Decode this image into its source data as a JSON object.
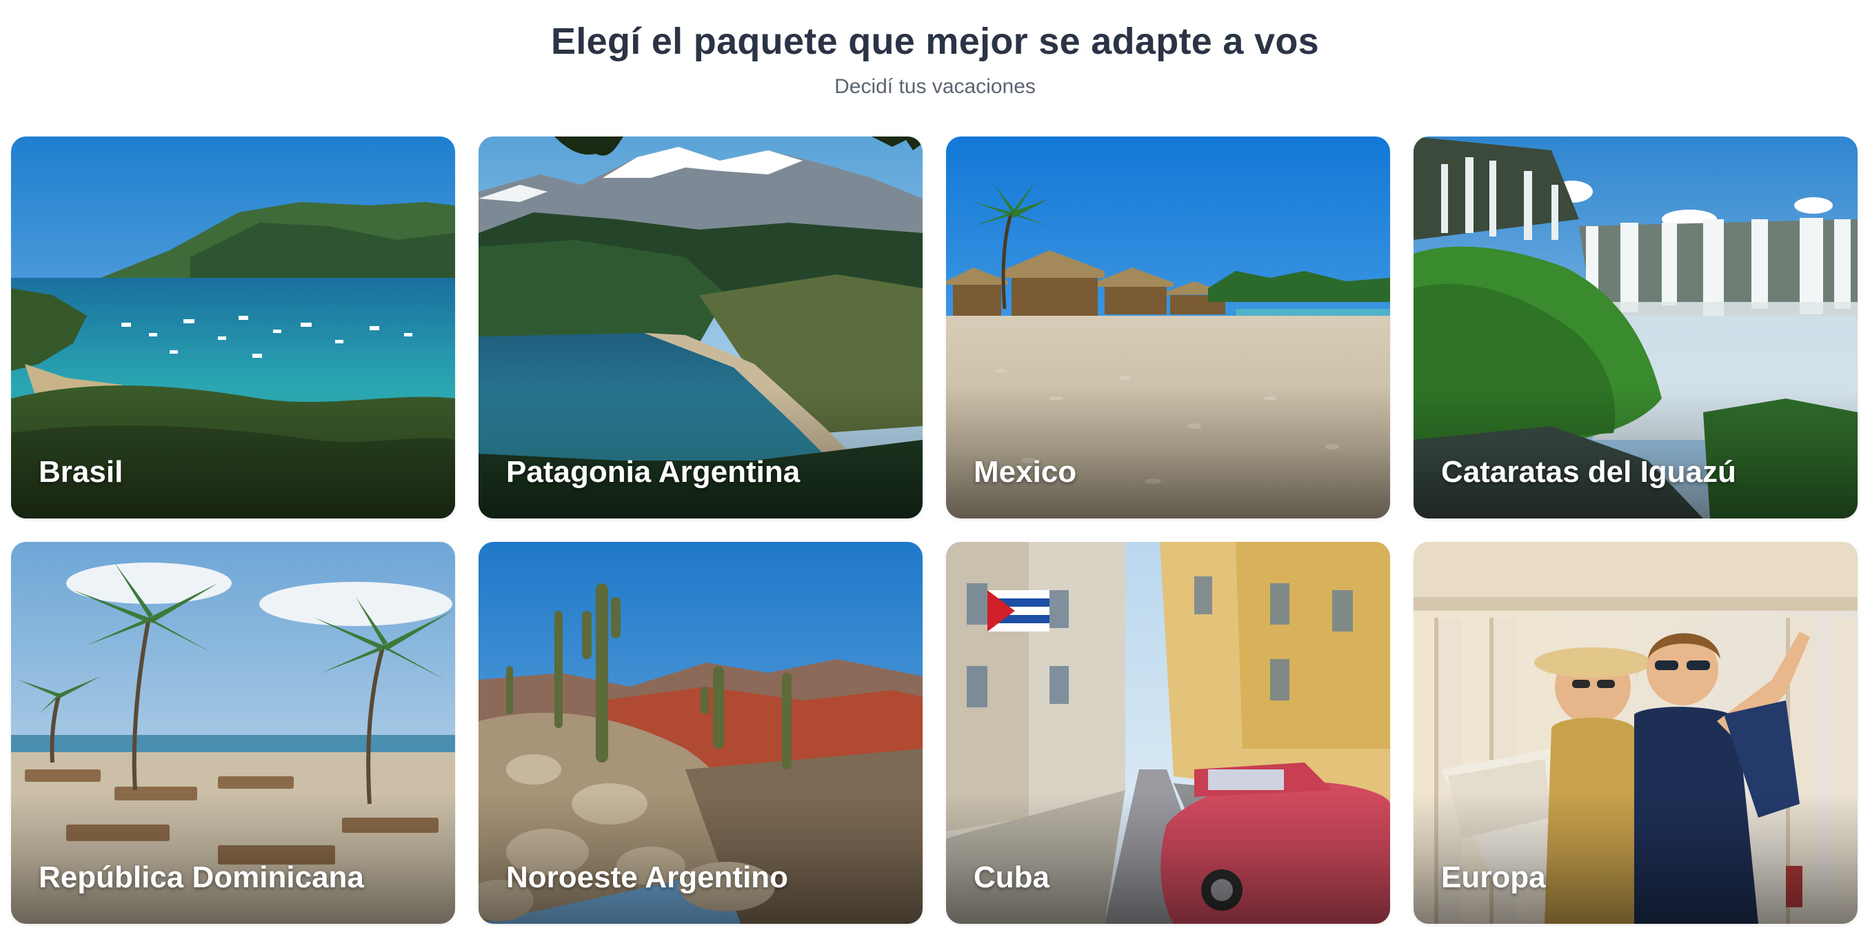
{
  "header": {
    "title": "Elegí el paquete que mejor se adapte a vos",
    "subtitle": "Decidí tus vacaciones"
  },
  "packages": [
    {
      "label": "Brasil",
      "image": "tropical-bay-with-boats"
    },
    {
      "label": "Patagonia Argentina",
      "image": "snowy-mountains-and-lake"
    },
    {
      "label": "Mexico",
      "image": "beach-with-palapas"
    },
    {
      "label": "Cataratas del Iguazú",
      "image": "waterfalls-and-jungle"
    },
    {
      "label": "República Dominicana",
      "image": "palm-beach-with-loungers"
    },
    {
      "label": "Noroeste Argentino",
      "image": "cacti-and-red-mountains"
    },
    {
      "label": "Cuba",
      "image": "colonial-street-with-classic-car"
    },
    {
      "label": "Europa",
      "image": "tourist-couple-with-map"
    }
  ],
  "colors": {
    "title": "#2b3445",
    "subtitle": "#5b6474",
    "card_label": "#ffffff"
  }
}
